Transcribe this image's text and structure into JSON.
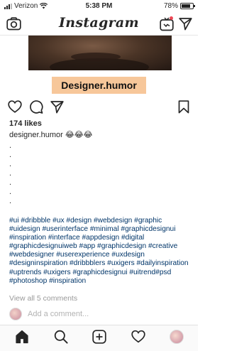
{
  "status_bar": {
    "carrier": "Verizon",
    "time": "5:38 PM",
    "battery": "78%",
    "battery_level": 0.78
  },
  "header": {
    "brand": "Instagram",
    "icons": [
      "camera-icon",
      "igtv-icon",
      "direct-message-icon"
    ],
    "notification_color": "#ed4956"
  },
  "post": {
    "image_caption": "Designer.humor",
    "likes": "174 likes",
    "username": "designer.humor",
    "caption_emojis": "😂😂😂",
    "dots": [
      ".",
      ".",
      ".",
      ".",
      ".",
      ".",
      "."
    ],
    "hashtags": "#ui #dribbble #ux #design #webdesign #graphic #uidesign #userinterface #minimal #graphicdesignui #inspiration #interface #appdesign #digital #graphicdesignuiweb #app #graphicdesign #creative #webdesigner #userexperience #uxdesign #designinspiration #dribbblers #uxigers #dailyinspiration #uptrends #uxigers #graphicdesignui #uitrend#psd #photoshop #inspiration",
    "view_comments": "View all 5 comments",
    "add_comment_placeholder": "Add a comment...",
    "hashtag_color": "#003569"
  },
  "tabbar": {
    "icons": [
      "home-icon",
      "search-icon",
      "add-post-icon",
      "activity-heart-icon",
      "profile-avatar"
    ]
  }
}
